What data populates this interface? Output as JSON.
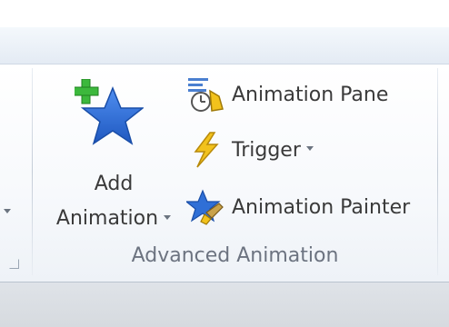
{
  "ribbon": {
    "add_animation": {
      "label_line1": "Add",
      "label_line2": "Animation"
    },
    "commands": {
      "animation_pane": "Animation Pane",
      "trigger": "Trigger",
      "animation_painter": "Animation Painter"
    },
    "group_label": "Advanced Animation"
  },
  "colors": {
    "star_blue": "#2f6fd6",
    "plus_green": "#3cb83c",
    "lightning_yellow": "#f2c21c",
    "text": "#3a3a3a",
    "group_label": "#6c7380"
  },
  "icons": {
    "add_animation": "star-with-plus-icon",
    "animation_pane": "animation-pane-icon",
    "trigger": "lightning-icon",
    "animation_painter": "star-brush-icon"
  }
}
